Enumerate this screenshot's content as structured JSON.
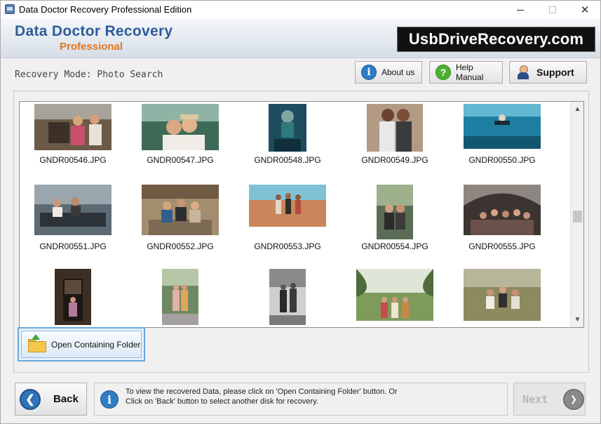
{
  "window": {
    "title": "Data Doctor Recovery Professional Edition",
    "minimize_icon": "minimize-icon",
    "maximize_icon": "maximize-icon",
    "close_glyph": "✕"
  },
  "banner": {
    "brand_main": "Data Doctor Recovery",
    "brand_sub": "Professional",
    "site": "UsbDriveRecovery.com",
    "brand_color": "#2d5d9a",
    "accent_color": "#e3751d"
  },
  "mode": {
    "label": "Recovery Mode: Photo Search"
  },
  "toolbar": {
    "about_label": "About us",
    "about_glyph": "i",
    "help_label": "Help Manual",
    "help_glyph": "?",
    "support_label": "Support"
  },
  "gallery": {
    "files": [
      "GNDR00546.JPG",
      "GNDR00547.JPG",
      "GNDR00548.JPG",
      "GNDR00549.JPG",
      "GNDR00550.JPG",
      "GNDR00551.JPG",
      "GNDR00552.JPG",
      "GNDR00553.JPG",
      "GNDR00554.JPG",
      "GNDR00555.JPG"
    ],
    "scroll_up_glyph": "▲",
    "scroll_down_glyph": "▼"
  },
  "actions": {
    "open_folder_label": "Open Containing Folder"
  },
  "footer": {
    "back_label": "Back",
    "back_glyph": "❮",
    "info_glyph": "i",
    "info_line1": "To view the recovered Data, please click on 'Open Containing Folder' button. Or",
    "info_line2": "Click on 'Back' button to select another disk for recovery.",
    "next_label": "Next",
    "next_glyph": "❯"
  }
}
